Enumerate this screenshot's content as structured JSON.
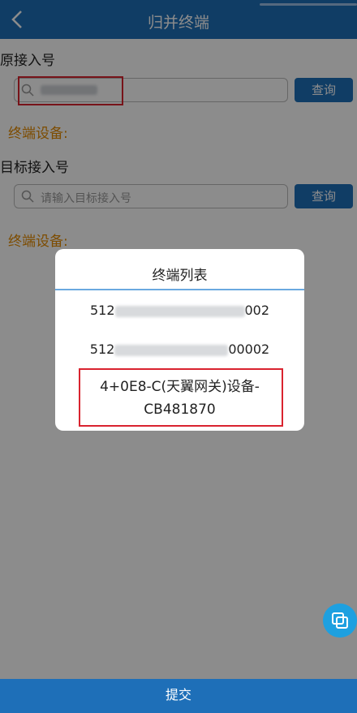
{
  "header": {
    "title": "归并终端"
  },
  "source": {
    "label": "原接入号",
    "device_label": "终端设备:",
    "query_label": "查询"
  },
  "target": {
    "label": "目标接入号",
    "placeholder": "请输入目标接入号",
    "device_label": "终端设备:",
    "query_label": "查询"
  },
  "modal": {
    "title": "终端列表",
    "items": [
      {
        "prefix": "512",
        "suffix": "002"
      },
      {
        "prefix": "512",
        "suffix": "00002"
      },
      {
        "line1": "4+0E8-C(天翼网关)设备-",
        "line2": "CB481870"
      }
    ]
  },
  "footer": {
    "submit_label": "提交"
  },
  "colors": {
    "primary": "#1e6fb8",
    "accent": "#e38a00",
    "highlight": "#d9232f"
  }
}
